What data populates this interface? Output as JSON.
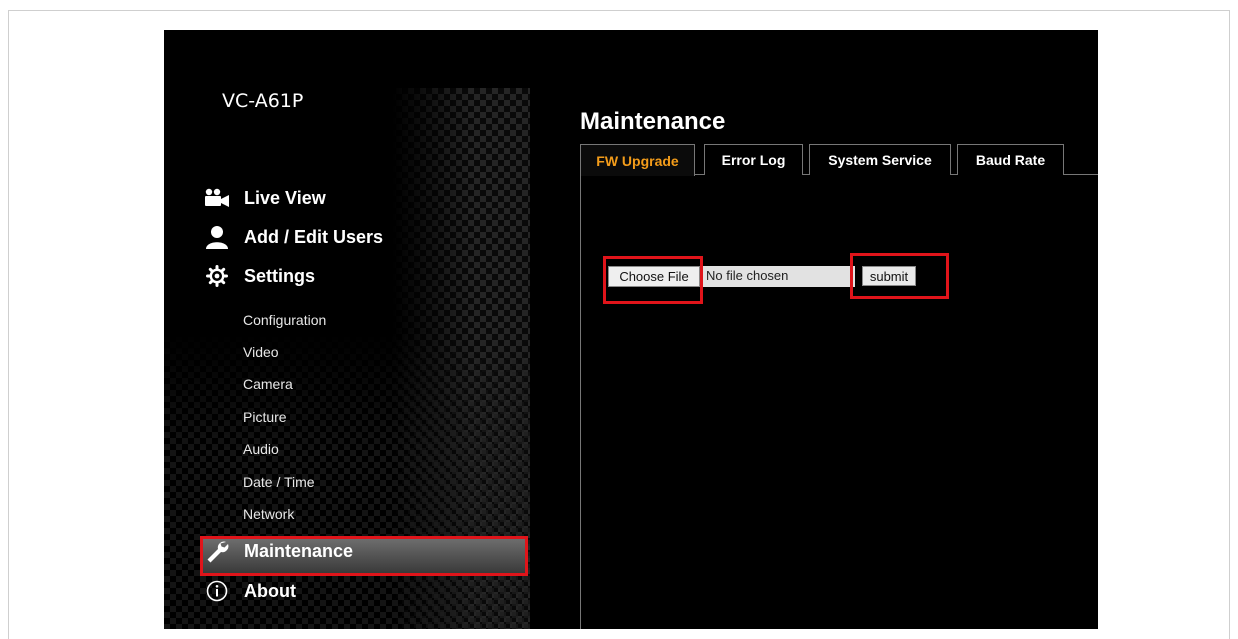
{
  "device": {
    "model": "VC-A61P"
  },
  "sidebar": {
    "main_items": [
      {
        "label": "Live View",
        "icon": "video-camera-icon"
      },
      {
        "label": "Add / Edit Users",
        "icon": "user-icon"
      },
      {
        "label": "Settings",
        "icon": "gear-icon"
      }
    ],
    "settings_items": [
      {
        "label": "Configuration"
      },
      {
        "label": "Video"
      },
      {
        "label": "Camera"
      },
      {
        "label": "Picture"
      },
      {
        "label": "Audio"
      },
      {
        "label": "Date / Time"
      },
      {
        "label": "Network"
      }
    ],
    "maintenance": {
      "label": "Maintenance",
      "icon": "wrench-icon"
    },
    "about": {
      "label": "About",
      "icon": "info-icon"
    }
  },
  "content": {
    "title": "Maintenance",
    "tabs": [
      {
        "label": "FW Upgrade",
        "active": true
      },
      {
        "label": "Error Log",
        "active": false
      },
      {
        "label": "System Service",
        "active": false
      },
      {
        "label": "Baud Rate",
        "active": false
      }
    ],
    "file_upload": {
      "choose_label": "Choose File",
      "status": "No file chosen",
      "submit_label": "submit"
    }
  },
  "colors": {
    "highlight": "#e0141a",
    "active_tab_text": "#f39c1a",
    "background": "#000000"
  }
}
